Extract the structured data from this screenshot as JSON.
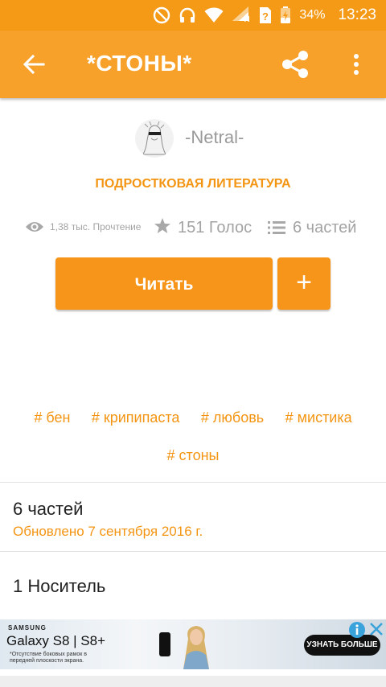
{
  "status_bar": {
    "icons": [
      "do-not-disturb-icon",
      "headset-icon",
      "wifi-icon",
      "signal-icon",
      "sim-unknown-icon",
      "battery-icon"
    ],
    "network_label": "H",
    "battery": "34%",
    "time": "13:23"
  },
  "app_bar": {
    "title": "*СТОНЫ*",
    "back_icon": "back-arrow-icon",
    "share_icon": "share-icon",
    "more_icon": "more-vert-icon"
  },
  "story": {
    "author": "-Netral-",
    "category": "ПОДРОСТКОВАЯ ЛИТЕРАТУРА",
    "reads": "1,38 тыс. Прочтение",
    "votes": "151 Голос",
    "parts": "6 частей",
    "read_label": "Читать",
    "add_label": "+",
    "tags": [
      "# бен",
      "# крипипаста",
      "# любовь",
      "# мистика",
      "# стоны"
    ]
  },
  "table_of_contents": {
    "count_label": "6 частей",
    "updated": "Обновлено 7 сентября 2016 г."
  },
  "carrier_section": {
    "label": "1 Носитель"
  },
  "ad": {
    "brand": "SAMSUNG",
    "model": "Galaxy S8 | S8+",
    "note": "*Отсутствие боковых рамок в передней плоскости экрана.",
    "cta": "УЗНАТЬ БОЛЬШЕ"
  },
  "colors": {
    "status_bar": "#f49a16",
    "app_bar": "#f7a12a",
    "accent": "#f39512",
    "button": "#f7951a",
    "muted_text": "#a3a3a3"
  }
}
